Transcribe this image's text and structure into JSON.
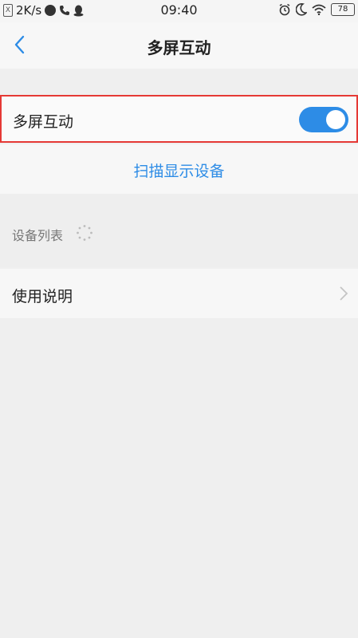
{
  "status_bar": {
    "net_speed": "2K/s",
    "time": "09:40",
    "battery": "78",
    "sim_glyph": "X"
  },
  "header": {
    "title": "多屏互动"
  },
  "multiscreen": {
    "label": "多屏互动",
    "enabled": true
  },
  "scan": {
    "label": "扫描显示设备"
  },
  "device_list": {
    "label": "设备列表"
  },
  "instructions": {
    "label": "使用说明"
  },
  "colors": {
    "accent": "#2d8ce6",
    "highlight_border": "#e53935"
  }
}
